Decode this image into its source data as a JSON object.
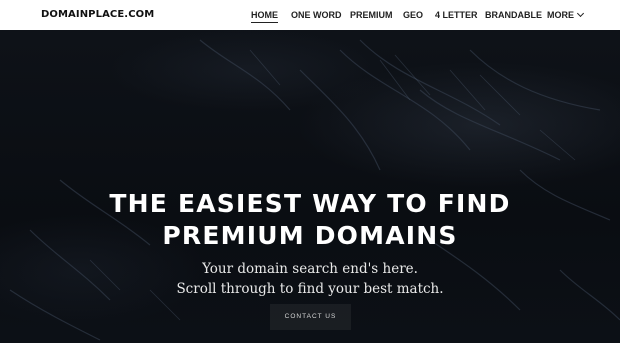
{
  "header": {
    "logo": "DOMAINPLACE.COM",
    "nav": [
      {
        "label": "HOME",
        "active": true
      },
      {
        "label": "ONE WORD",
        "active": false
      },
      {
        "label": "PREMIUM",
        "active": false
      },
      {
        "label": "GEO",
        "active": false
      },
      {
        "label": "4 LETTER",
        "active": false
      },
      {
        "label": "BRANDABLE",
        "active": false
      },
      {
        "label": "MORE",
        "active": false,
        "icon": "chevron-down-icon"
      }
    ]
  },
  "hero": {
    "title_line1": "THE EASIEST WAY TO FIND",
    "title_line2": "PREMIUM DOMAINS",
    "subtitle_line1": "Your domain search end's here.",
    "subtitle_line2": "Scroll through to find your best match.",
    "cta_label": "CONTACT US"
  },
  "colors": {
    "header_bg": "#ffffff",
    "hero_bg": "#0b0e13",
    "text_light": "#ffffff"
  }
}
